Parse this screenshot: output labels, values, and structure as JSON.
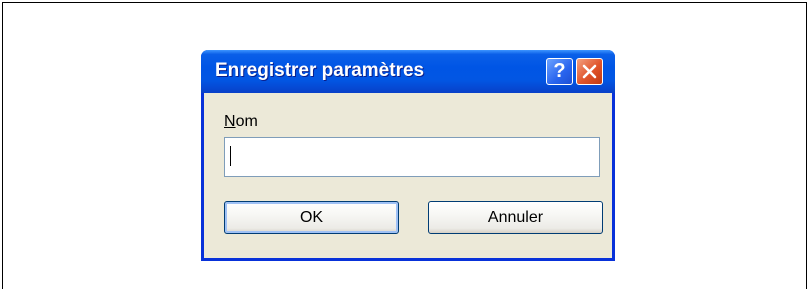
{
  "dialog": {
    "title": "Enregistrer paramètres",
    "help_glyph": "?",
    "name_label_accesskey": "N",
    "name_label_rest": "om",
    "name_value": "",
    "ok_label": "OK",
    "cancel_label": "Annuler"
  },
  "colors": {
    "titlebar": "#0055e5",
    "dialog_bg": "#ece9d8",
    "frame_border": "#0831d9",
    "close_button": "#e0542a",
    "button_border": "#003c74"
  },
  "icons": {
    "help": "help-icon",
    "close": "close-icon"
  }
}
